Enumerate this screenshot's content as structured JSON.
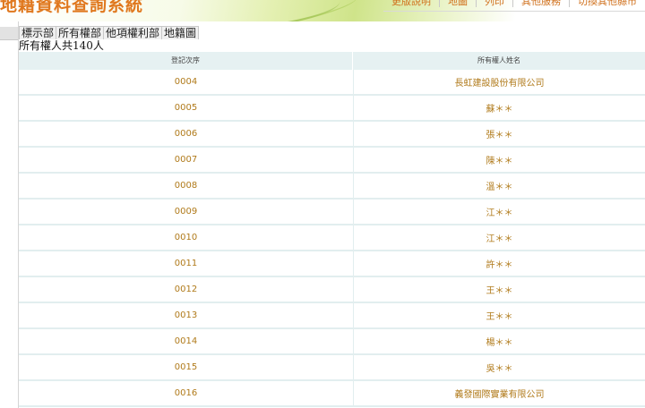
{
  "header": {
    "site_title": "地籍資料查詢系統",
    "nav": [
      "更版說明",
      "地圖",
      "列印",
      "其他服務",
      "切換其他縣市"
    ]
  },
  "tabs": [
    "標示部",
    "所有權部",
    "他項權利部",
    "地籍圖"
  ],
  "owner_count_text": "所有權人共140人",
  "table": {
    "columns": [
      "登記次序",
      "所有權人姓名"
    ],
    "rows": [
      {
        "seq": "0004",
        "name": "長虹建設股份有限公司"
      },
      {
        "seq": "0005",
        "name": "蘇＊＊"
      },
      {
        "seq": "0006",
        "name": "張＊＊"
      },
      {
        "seq": "0007",
        "name": "陳＊＊"
      },
      {
        "seq": "0008",
        "name": "溫＊＊"
      },
      {
        "seq": "0009",
        "name": "江＊＊"
      },
      {
        "seq": "0010",
        "name": "江＊＊"
      },
      {
        "seq": "0011",
        "name": "許＊＊"
      },
      {
        "seq": "0012",
        "name": "王＊＊"
      },
      {
        "seq": "0013",
        "name": "王＊＊"
      },
      {
        "seq": "0014",
        "name": "楊＊＊"
      },
      {
        "seq": "0015",
        "name": "吳＊＊"
      },
      {
        "seq": "0016",
        "name": "義發國際實業有限公司"
      }
    ]
  },
  "colors": {
    "title": "#e0781e",
    "nav_text": "#d0701c",
    "cell_text": "#b07a1a",
    "header_bg": "#e6f1f2"
  }
}
